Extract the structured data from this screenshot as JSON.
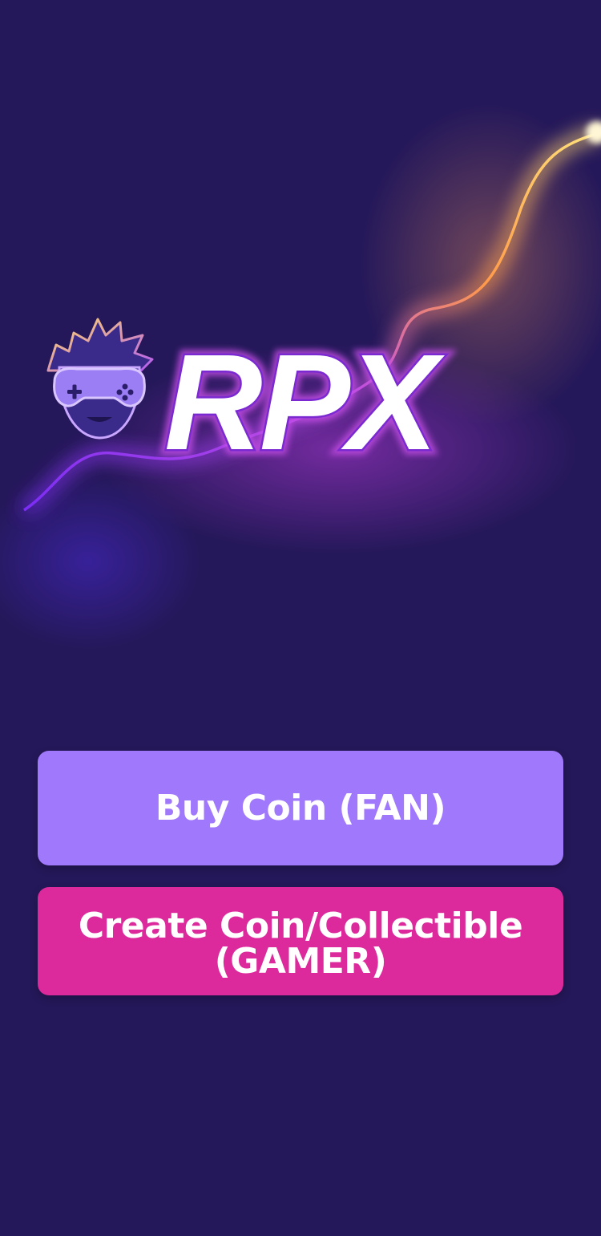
{
  "logo": {
    "wordmark": "RPX",
    "icon": "gamer-mascot-icon"
  },
  "actions": {
    "buy_coin_label": "Buy Coin (FAN)",
    "create_coin_line1": "Create Coin/Collectible",
    "create_coin_line2": "(GAMER)"
  },
  "colors": {
    "background": "#25185a",
    "buy_button": "#a078fb",
    "create_button": "#dc2a9c",
    "glow_start": "#8a2cf0",
    "glow_end": "#ffc25a"
  }
}
